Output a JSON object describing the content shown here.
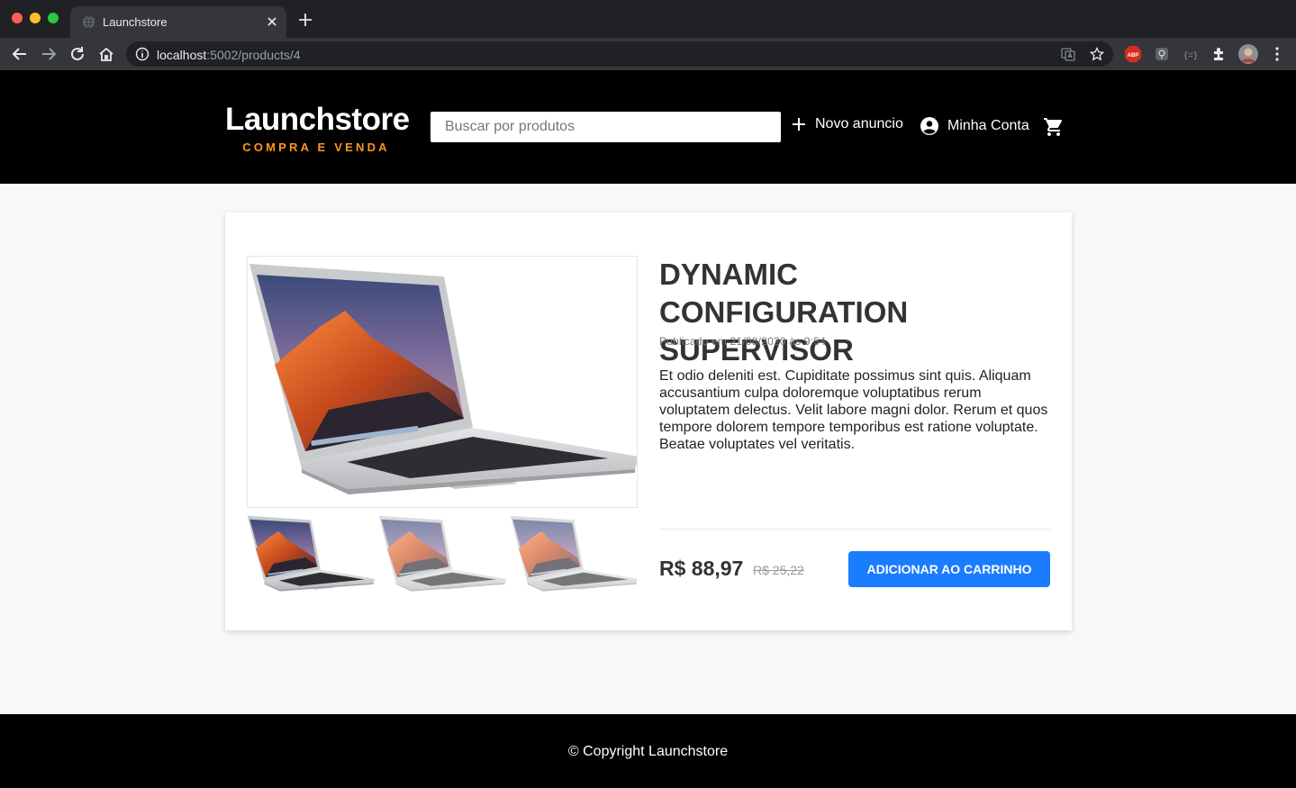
{
  "browser": {
    "tab_title": "Launchstore",
    "url_host": "localhost",
    "url_rest": ":5002/products/4"
  },
  "header": {
    "logo_title": "Launchstore",
    "logo_subtitle": "COMPRA E VENDA",
    "search_placeholder": "Buscar por produtos",
    "new_ad_label": "Novo anuncio",
    "account_label": "Minha Conta"
  },
  "product": {
    "title": "DYNAMIC CONFIGURATION SUPERVISOR",
    "published": "Publicado em 21/08/2020 às 9:54",
    "description": "Et odio deleniti est. Cupiditate possimus sint quis. Aliquam accusantium culpa doloremque voluptatibus rerum voluptatem delectus. Velit labore magni dolor. Rerum et quos tempore dolorem tempore temporibus est ratione voluptate. Beatae voluptates vel veritatis.",
    "price": "R$ 88,97",
    "old_price": "R$ 25,22",
    "button_label": "ADICIONAR AO CARRINHO",
    "thumbnails": 3
  },
  "footer": {
    "copyright": "© Copyright Launchstore"
  },
  "colors": {
    "accent": "#1a7cff",
    "logo_subtitle": "#fd951f",
    "header_bg": "#000000"
  }
}
